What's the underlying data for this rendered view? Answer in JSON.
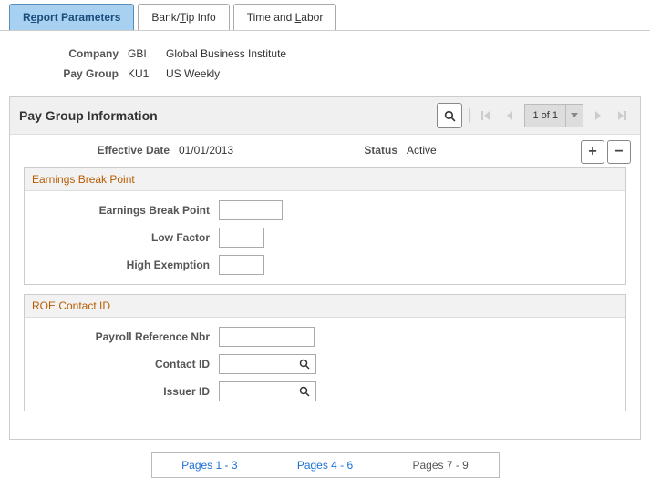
{
  "tabs": {
    "report_params": {
      "pre": "R",
      "u": "e",
      "post": "port Parameters"
    },
    "bank_tip": {
      "pre": "Bank/",
      "u": "T",
      "post": "ip Info"
    },
    "time_labor": {
      "pre": "Time and ",
      "u": "L",
      "post": "abor"
    }
  },
  "header": {
    "company_label": "Company",
    "company_code": "GBI",
    "company_name": "Global Business Institute",
    "paygroup_label": "Pay Group",
    "paygroup_code": "KU1",
    "paygroup_name": "US Weekly"
  },
  "panel": {
    "title": "Pay Group Information",
    "page_indicator": "1 of 1"
  },
  "status_row": {
    "eff_label": "Effective Date",
    "eff_value": "01/01/2013",
    "status_label": "Status",
    "status_value": "Active"
  },
  "earnings": {
    "title": "Earnings Break Point",
    "bp_label": "Earnings Break Point",
    "bp_value": "",
    "low_label": "Low Factor",
    "low_value": "",
    "high_label": "High Exemption",
    "high_value": ""
  },
  "roe": {
    "title": "ROE Contact ID",
    "payref_label": "Payroll Reference Nbr",
    "payref_value": "",
    "contact_label": "Contact ID",
    "contact_value": "",
    "issuer_label": "Issuer ID",
    "issuer_value": ""
  },
  "pagination": {
    "p1": "Pages 1 - 3",
    "p2": "Pages 4 - 6",
    "p3": "Pages 7 - 9"
  },
  "icons": {
    "plus": "+",
    "minus": "−"
  }
}
